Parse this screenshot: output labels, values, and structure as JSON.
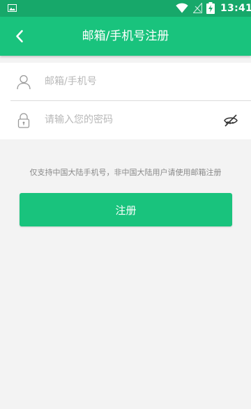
{
  "status_bar": {
    "time": "13:41",
    "icons": [
      "gallery-icon",
      "wifi-icon",
      "no-signal-icon",
      "battery-charging-icon"
    ]
  },
  "header": {
    "title": "邮箱/手机号注册",
    "back_icon": "chevron-left-icon"
  },
  "form": {
    "account": {
      "placeholder": "邮箱/手机号",
      "value": "",
      "icon": "user-icon"
    },
    "password": {
      "placeholder": "请输入您的密码",
      "value": "",
      "icon": "lock-icon",
      "toggle_icon": "eye-off-icon"
    }
  },
  "hint": "仅支持中国大陆手机号，非中国大陆用户请使用邮箱注册",
  "register_button": "注册",
  "colors": {
    "status_bar": "#17a86a",
    "primary": "#19c37d",
    "background": "#f3f3f3",
    "placeholder": "#b8b8b8",
    "hint": "#888888"
  }
}
